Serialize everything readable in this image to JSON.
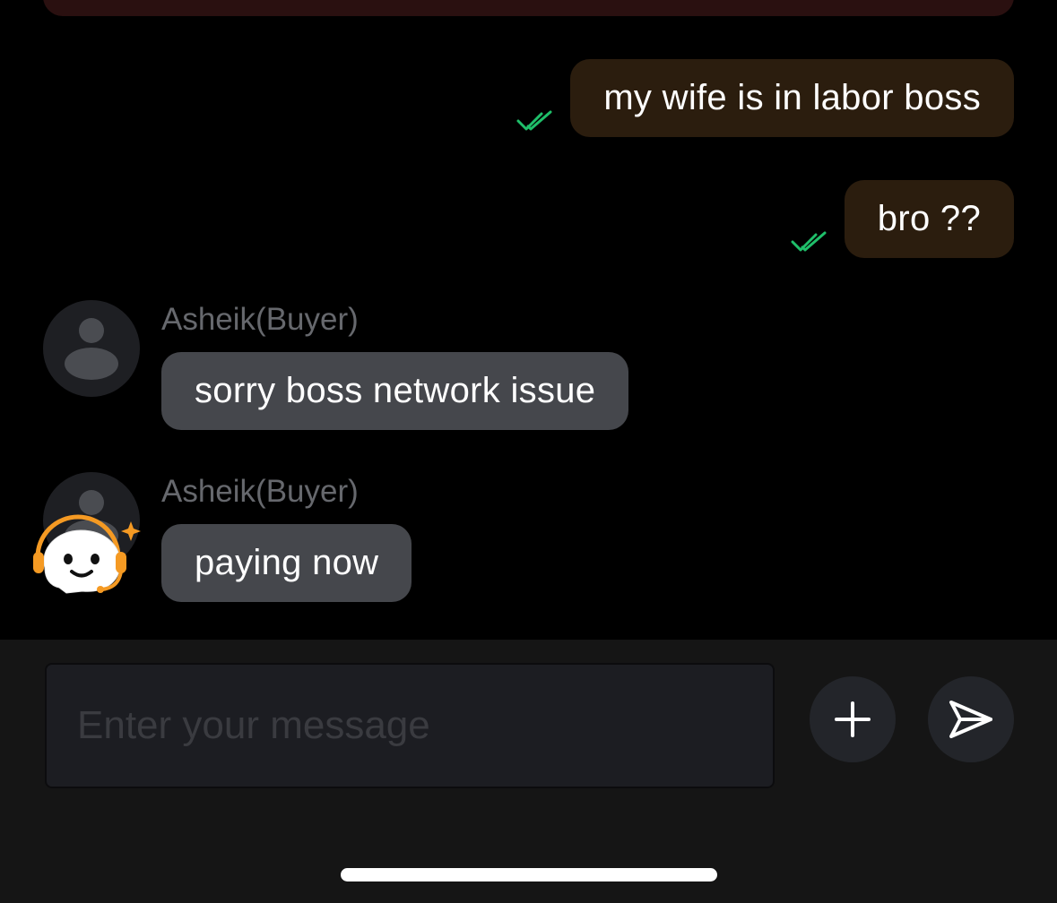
{
  "messages_outgoing": [
    {
      "text": "my wife is in labor boss",
      "status": "read"
    },
    {
      "text": "bro ??",
      "status": "read"
    }
  ],
  "messages_incoming": [
    {
      "sender": "Asheik(Buyer)",
      "text": "sorry boss network issue"
    },
    {
      "sender": "Asheik(Buyer)",
      "text": "paying now"
    }
  ],
  "composer": {
    "placeholder": "Enter your message",
    "value": ""
  },
  "icons": {
    "read_receipt": "double-check-icon",
    "attach": "plus-icon",
    "send": "send-icon",
    "support": "support-mascot-icon"
  },
  "colors": {
    "outgoing_bubble": "#2b1d0e",
    "incoming_bubble": "#45474c",
    "read_check": "#1fbf6a",
    "support_accent": "#f59a23"
  }
}
